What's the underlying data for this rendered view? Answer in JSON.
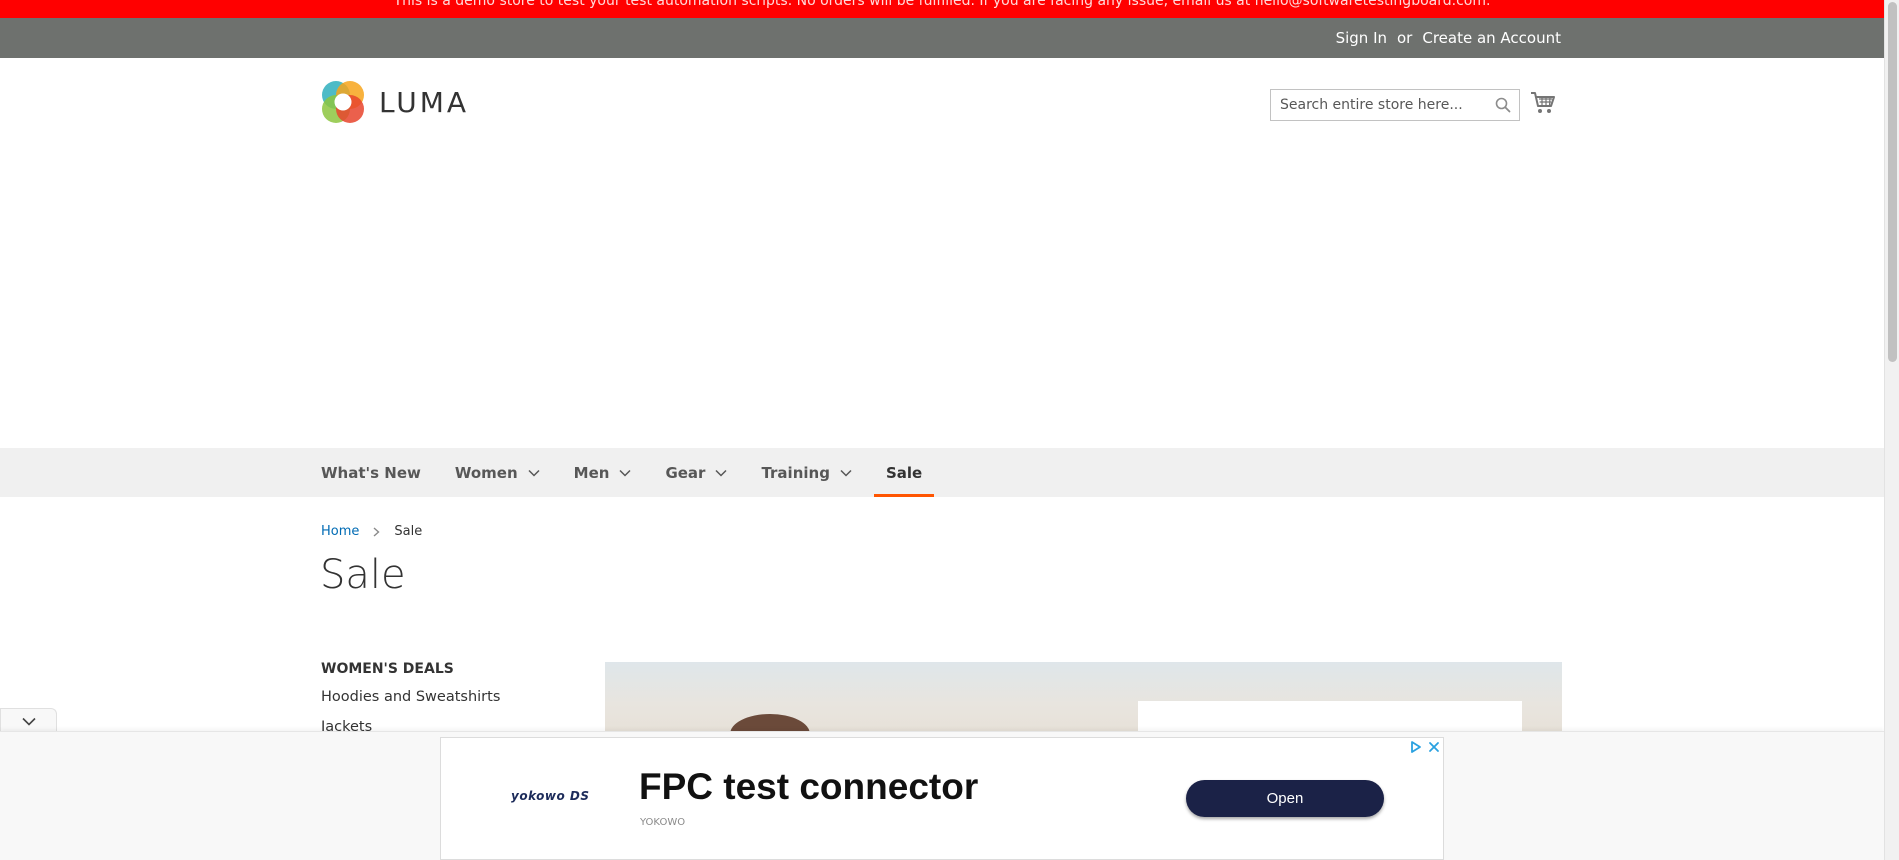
{
  "notice": {
    "text": "This is a demo store to test your test automation scripts. No orders will be fulfilled. If you are facing any issue, email us at hello@softwaretestingboard.com."
  },
  "header": {
    "sign_in": "Sign In",
    "or": "or",
    "create_account": "Create an Account"
  },
  "logo": {
    "text": "LUMA"
  },
  "search": {
    "placeholder": "Search entire store here..."
  },
  "nav": {
    "items": [
      {
        "label": "What's New",
        "has_dropdown": false
      },
      {
        "label": "Women",
        "has_dropdown": true
      },
      {
        "label": "Men",
        "has_dropdown": true
      },
      {
        "label": "Gear",
        "has_dropdown": true
      },
      {
        "label": "Training",
        "has_dropdown": true
      },
      {
        "label": "Sale",
        "has_dropdown": false,
        "active": true
      }
    ]
  },
  "breadcrumb": {
    "home": "Home",
    "current": "Sale"
  },
  "page": {
    "title": "Sale"
  },
  "sidebar": {
    "heading": "WOMEN'S DEALS",
    "items": [
      "Hoodies and Sweatshirts",
      "Jackets"
    ]
  },
  "ad": {
    "brand_logo": "yokowo DS",
    "title": "FPC test connector",
    "subtitle": "YOKOWO",
    "cta": "Open"
  },
  "colors": {
    "notice_bg": "#ff0000",
    "header_bg": "#6e716e",
    "nav_bg": "#f0f0f0",
    "active_underline": "#ff5501",
    "link": "#006bb4",
    "ad_button": "#1b2247"
  }
}
